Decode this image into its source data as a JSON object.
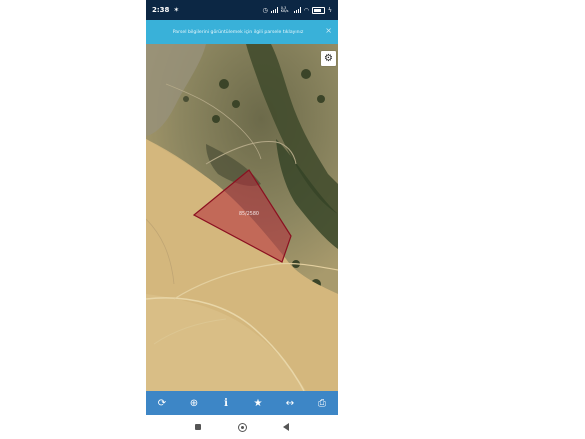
{
  "status_bar": {
    "time": "2:38",
    "data_speed": "0.3 KB/s",
    "battery_level": 0.85
  },
  "banner": {
    "text": "Parsel bilgilerini görüntülemek için ilgili parsele tıklayınız",
    "close_label": "×"
  },
  "map": {
    "parcel_label": "85/2580"
  },
  "toolbar": {
    "items": [
      {
        "name": "refresh",
        "icon": "refresh-icon",
        "glyph": "⟳"
      },
      {
        "name": "locate",
        "icon": "crosshair-icon",
        "glyph": "⊕"
      },
      {
        "name": "info",
        "icon": "info-icon",
        "glyph": "i"
      },
      {
        "name": "favorite",
        "icon": "star-icon",
        "glyph": "★"
      },
      {
        "name": "measure",
        "icon": "ruler-icon",
        "glyph": "↔"
      },
      {
        "name": "print",
        "icon": "print-icon",
        "glyph": "⎙"
      }
    ]
  },
  "colors": {
    "status_bar": "#0c2744",
    "banner": "#39b1d9",
    "toolbar": "#3d86c6",
    "parcel_fill": "#b32a3a",
    "parcel_stroke": "#8b1020"
  }
}
